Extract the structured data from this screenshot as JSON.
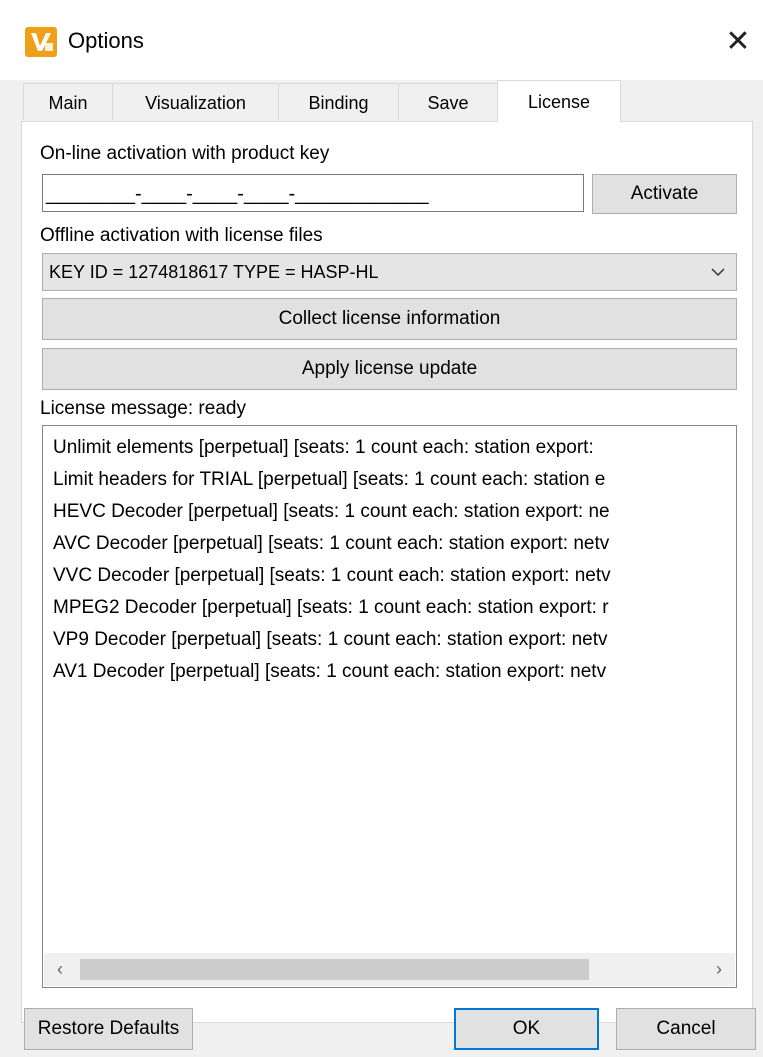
{
  "window": {
    "title": "Options",
    "close_glyph": "✕",
    "icon": "app-logo-icon",
    "icon_color": "#f0a018"
  },
  "tabs": [
    {
      "label": "Main"
    },
    {
      "label": "Visualization"
    },
    {
      "label": "Binding"
    },
    {
      "label": "Save"
    },
    {
      "label": "License",
      "active": true
    }
  ],
  "license": {
    "online_label": "On-line activation with product key",
    "product_key_value": "________-____-____-____-____________",
    "activate_label": "Activate",
    "offline_label": "Offline activation with license files",
    "license_file_selected": "KEY ID = 1274818617 TYPE = HASP-HL",
    "collect_label": "Collect license information",
    "apply_label": "Apply license update",
    "message_label": "License message: ready",
    "entries": [
      "Unlimit elements [perpetual] [seats: 1 count each: station export:",
      "Limit headers for TRIAL [perpetual] [seats: 1 count each: station e",
      "HEVC Decoder [perpetual] [seats: 1 count each: station export: ne",
      "AVC Decoder [perpetual] [seats: 1 count each: station export: netv",
      "VVC Decoder [perpetual] [seats: 1 count each: station export: netv",
      "MPEG2 Decoder [perpetual] [seats: 1 count each: station export: r",
      "VP9 Decoder [perpetual] [seats: 1 count each: station export: netv",
      "AV1 Decoder [perpetual] [seats: 1 count each: station export: netv"
    ]
  },
  "footer": {
    "restore_label": "Restore Defaults",
    "ok_label": "OK",
    "cancel_label": "Cancel"
  },
  "colors": {
    "focus_border": "#0078d7",
    "button_bg": "#e1e1e1"
  }
}
